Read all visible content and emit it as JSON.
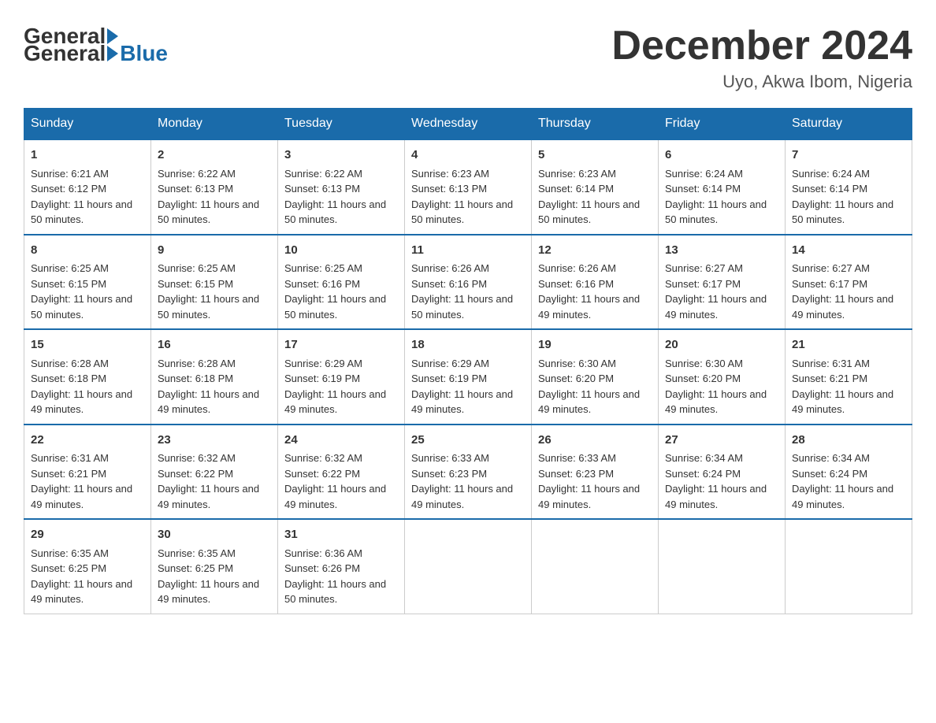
{
  "header": {
    "logo_general": "General",
    "logo_blue": "Blue",
    "month_title": "December 2024",
    "location": "Uyo, Akwa Ibom, Nigeria"
  },
  "weekdays": [
    "Sunday",
    "Monday",
    "Tuesday",
    "Wednesday",
    "Thursday",
    "Friday",
    "Saturday"
  ],
  "weeks": [
    [
      {
        "day": "1",
        "sunrise": "6:21 AM",
        "sunset": "6:12 PM",
        "daylight": "11 hours and 50 minutes."
      },
      {
        "day": "2",
        "sunrise": "6:22 AM",
        "sunset": "6:13 PM",
        "daylight": "11 hours and 50 minutes."
      },
      {
        "day": "3",
        "sunrise": "6:22 AM",
        "sunset": "6:13 PM",
        "daylight": "11 hours and 50 minutes."
      },
      {
        "day": "4",
        "sunrise": "6:23 AM",
        "sunset": "6:13 PM",
        "daylight": "11 hours and 50 minutes."
      },
      {
        "day": "5",
        "sunrise": "6:23 AM",
        "sunset": "6:14 PM",
        "daylight": "11 hours and 50 minutes."
      },
      {
        "day": "6",
        "sunrise": "6:24 AM",
        "sunset": "6:14 PM",
        "daylight": "11 hours and 50 minutes."
      },
      {
        "day": "7",
        "sunrise": "6:24 AM",
        "sunset": "6:14 PM",
        "daylight": "11 hours and 50 minutes."
      }
    ],
    [
      {
        "day": "8",
        "sunrise": "6:25 AM",
        "sunset": "6:15 PM",
        "daylight": "11 hours and 50 minutes."
      },
      {
        "day": "9",
        "sunrise": "6:25 AM",
        "sunset": "6:15 PM",
        "daylight": "11 hours and 50 minutes."
      },
      {
        "day": "10",
        "sunrise": "6:25 AM",
        "sunset": "6:16 PM",
        "daylight": "11 hours and 50 minutes."
      },
      {
        "day": "11",
        "sunrise": "6:26 AM",
        "sunset": "6:16 PM",
        "daylight": "11 hours and 50 minutes."
      },
      {
        "day": "12",
        "sunrise": "6:26 AM",
        "sunset": "6:16 PM",
        "daylight": "11 hours and 49 minutes."
      },
      {
        "day": "13",
        "sunrise": "6:27 AM",
        "sunset": "6:17 PM",
        "daylight": "11 hours and 49 minutes."
      },
      {
        "day": "14",
        "sunrise": "6:27 AM",
        "sunset": "6:17 PM",
        "daylight": "11 hours and 49 minutes."
      }
    ],
    [
      {
        "day": "15",
        "sunrise": "6:28 AM",
        "sunset": "6:18 PM",
        "daylight": "11 hours and 49 minutes."
      },
      {
        "day": "16",
        "sunrise": "6:28 AM",
        "sunset": "6:18 PM",
        "daylight": "11 hours and 49 minutes."
      },
      {
        "day": "17",
        "sunrise": "6:29 AM",
        "sunset": "6:19 PM",
        "daylight": "11 hours and 49 minutes."
      },
      {
        "day": "18",
        "sunrise": "6:29 AM",
        "sunset": "6:19 PM",
        "daylight": "11 hours and 49 minutes."
      },
      {
        "day": "19",
        "sunrise": "6:30 AM",
        "sunset": "6:20 PM",
        "daylight": "11 hours and 49 minutes."
      },
      {
        "day": "20",
        "sunrise": "6:30 AM",
        "sunset": "6:20 PM",
        "daylight": "11 hours and 49 minutes."
      },
      {
        "day": "21",
        "sunrise": "6:31 AM",
        "sunset": "6:21 PM",
        "daylight": "11 hours and 49 minutes."
      }
    ],
    [
      {
        "day": "22",
        "sunrise": "6:31 AM",
        "sunset": "6:21 PM",
        "daylight": "11 hours and 49 minutes."
      },
      {
        "day": "23",
        "sunrise": "6:32 AM",
        "sunset": "6:22 PM",
        "daylight": "11 hours and 49 minutes."
      },
      {
        "day": "24",
        "sunrise": "6:32 AM",
        "sunset": "6:22 PM",
        "daylight": "11 hours and 49 minutes."
      },
      {
        "day": "25",
        "sunrise": "6:33 AM",
        "sunset": "6:23 PM",
        "daylight": "11 hours and 49 minutes."
      },
      {
        "day": "26",
        "sunrise": "6:33 AM",
        "sunset": "6:23 PM",
        "daylight": "11 hours and 49 minutes."
      },
      {
        "day": "27",
        "sunrise": "6:34 AM",
        "sunset": "6:24 PM",
        "daylight": "11 hours and 49 minutes."
      },
      {
        "day": "28",
        "sunrise": "6:34 AM",
        "sunset": "6:24 PM",
        "daylight": "11 hours and 49 minutes."
      }
    ],
    [
      {
        "day": "29",
        "sunrise": "6:35 AM",
        "sunset": "6:25 PM",
        "daylight": "11 hours and 49 minutes."
      },
      {
        "day": "30",
        "sunrise": "6:35 AM",
        "sunset": "6:25 PM",
        "daylight": "11 hours and 49 minutes."
      },
      {
        "day": "31",
        "sunrise": "6:36 AM",
        "sunset": "6:26 PM",
        "daylight": "11 hours and 50 minutes."
      },
      null,
      null,
      null,
      null
    ]
  ],
  "labels": {
    "sunrise_prefix": "Sunrise: ",
    "sunset_prefix": "Sunset: ",
    "daylight_prefix": "Daylight: "
  }
}
